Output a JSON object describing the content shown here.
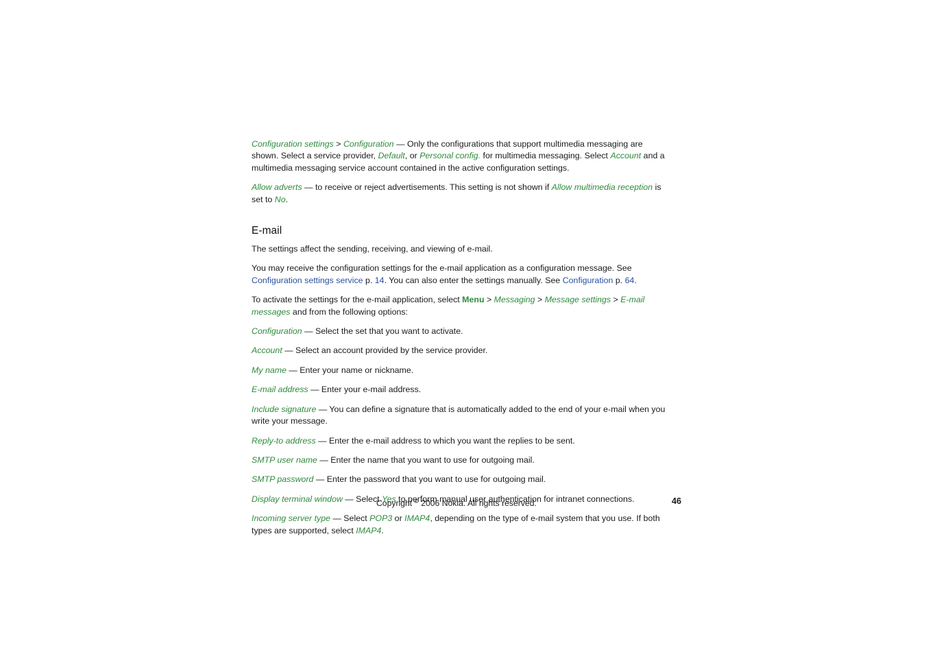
{
  "document": {
    "section_heading": "E-mail",
    "footer": {
      "copyright_prefix": "Copyright ",
      "copyright_symbol": "©",
      "copyright_suffix": " 2006 Nokia. All rights reserved.",
      "page_number": "46"
    },
    "colors": {
      "accent_green": "#2E8B3C",
      "link_blue": "#2B4FA0",
      "body_text": "#1a1a1a",
      "background": "#ffffff"
    },
    "paragraphs": {
      "config_settings": {
        "term1": "Configuration settings",
        "sep1": " > ",
        "term2": "Configuration",
        "body1": " — Only the configurations that support multimedia messaging are shown. Select a service provider, ",
        "term3": "Default",
        "body2": ", or ",
        "term4": "Personal config.",
        "body3": " for multimedia messaging. Select ",
        "term5": "Account",
        "body4": " and a multimedia messaging service account contained in the active configuration settings."
      },
      "allow_adverts": {
        "term1": "Allow adverts",
        "body1": " — to receive or reject advertisements. This setting is not shown if ",
        "term2": "Allow multimedia reception",
        "body2": " is set to ",
        "term3": "No",
        "body3": "."
      },
      "email_intro": "The settings affect the sending, receiving, and viewing of e-mail.",
      "email_config_msg": {
        "body1": "You may receive the configuration settings for the e-mail application as a configuration message. See ",
        "link1": "Configuration settings service",
        "body2": " p. ",
        "link2": "14",
        "body3": ". You can also enter the settings manually. See ",
        "link3": "Configuration",
        "body4": " p. ",
        "link4": "64",
        "body5": "."
      },
      "activate_settings": {
        "body1": "To activate the settings for the e-mail application, select ",
        "term_bold": "Menu",
        "sep1": " > ",
        "term1": "Messaging",
        "sep2": " > ",
        "term2": "Message settings",
        "sep3": " > ",
        "term3": "E-mail messages",
        "body2": " and from the following options:"
      }
    },
    "options": [
      {
        "term": "Configuration",
        "description": " — Select the set that you want to activate."
      },
      {
        "term": "Account",
        "description": " — Select an account provided by the service provider."
      },
      {
        "term": "My name",
        "description": " — Enter your name or nickname."
      },
      {
        "term": "E-mail address",
        "description": " — Enter your e-mail address."
      },
      {
        "term": "Include signature",
        "description": " — You can define a signature that is automatically added to the end of your e-mail when you write your message."
      },
      {
        "term": "Reply-to address",
        "description": " — Enter the e-mail address to which you want the replies to be sent."
      },
      {
        "term": "SMTP user name",
        "description": " — Enter the name that you want to use for outgoing mail."
      },
      {
        "term": "SMTP password",
        "description": " — Enter the password that you want to use for outgoing mail."
      }
    ],
    "option_display_terminal": {
      "term": "Display terminal window",
      "body1": " — Select ",
      "value1": "Yes",
      "body2": " to perform manual user authentication for intranet connections."
    },
    "option_incoming_server": {
      "term": "Incoming server type",
      "body1": " — Select ",
      "value1": "POP3",
      "body2": " or ",
      "value2": "IMAP4",
      "body3": ", depending on the type of e-mail system that you use. If both types are supported, select ",
      "value3": "IMAP4",
      "body4": "."
    }
  }
}
